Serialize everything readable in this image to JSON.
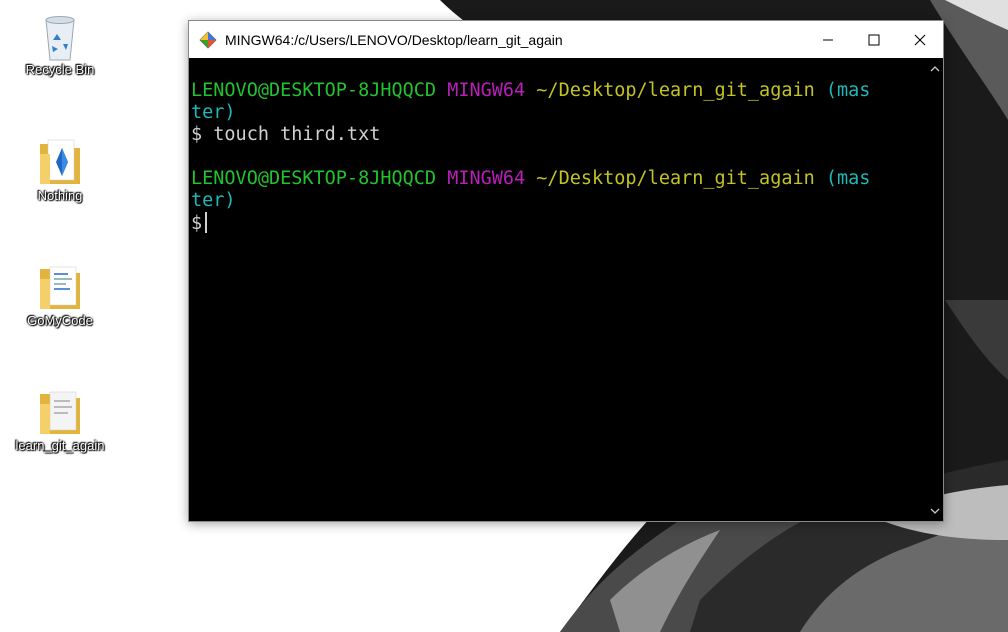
{
  "desktop": {
    "icons": [
      {
        "label": "Recycle Bin",
        "icon": "recycle-bin-icon"
      },
      {
        "label": "Nothing",
        "icon": "folder-icon"
      },
      {
        "label": "GoMyCode",
        "icon": "folder-icon"
      },
      {
        "label": "learn_git_again",
        "icon": "folder-icon"
      }
    ]
  },
  "terminal": {
    "title": "MINGW64:/c/Users/LENOVO/Desktop/learn_git_again",
    "app_icon": "git-diamond-icon",
    "controls": {
      "minimize": "minimize-icon",
      "maximize": "maximize-icon",
      "close": "close-icon"
    },
    "blocks": [
      {
        "user_host": "LENOVO@DESKTOP-8JHQQCD",
        "shell": "MINGW64",
        "path": "~/Desktop/learn_git_again",
        "branch_part1": "(mas",
        "branch_part2": "ter)",
        "prompt": "$",
        "command": "touch third.txt"
      },
      {
        "user_host": "LENOVO@DESKTOP-8JHQQCD",
        "shell": "MINGW64",
        "path": "~/Desktop/learn_git_again",
        "branch_part1": "(mas",
        "branch_part2": "ter)",
        "prompt": "$",
        "command": ""
      }
    ]
  },
  "colors": {
    "user_host": "#22c32e",
    "shell": "#b81fb8",
    "path": "#c3c322",
    "branch": "#1fb8b8",
    "text": "#d0d0d0",
    "background": "#000000"
  }
}
